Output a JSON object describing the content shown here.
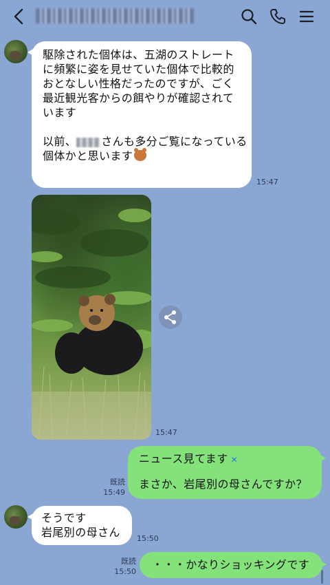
{
  "header": {
    "title_blurred": true
  },
  "messages": {
    "m1": {
      "lines_a": [
        "駆除された個体は、五湖のストレート",
        "に頻繁に姿を見せていた個体で比較的",
        "おとなしい性格だったのですが、ごく",
        "最近観光客からの餌やりが確認されて",
        "います"
      ],
      "line_b1_suffix": "さんも多分ご覧になっている",
      "line_b1_prefix": "以前、",
      "line_b2": "個体かと思います",
      "time": "15:47"
    },
    "m2": {
      "time": "15:47"
    },
    "m3": {
      "line1": "ニュース見てます",
      "line2": "まさか、岩尾別の母さんですか？",
      "read": "既読",
      "time": "15:49"
    },
    "m4": {
      "line1": "そうです",
      "line2": "岩尾別の母さん",
      "time": "15:50"
    },
    "m5": {
      "text": "・・・かなりショッキングです",
      "read": "既読",
      "time": "15:50"
    }
  },
  "colors": {
    "background": "#8aa6d2",
    "incoming_bubble": "#ffffff",
    "outgoing_bubble": "#84e27a"
  },
  "icons": [
    "back-arrow-icon",
    "search-icon",
    "phone-icon",
    "menu-icon",
    "share-icon",
    "bear-emoji-icon",
    "crying-emoji-icon"
  ]
}
